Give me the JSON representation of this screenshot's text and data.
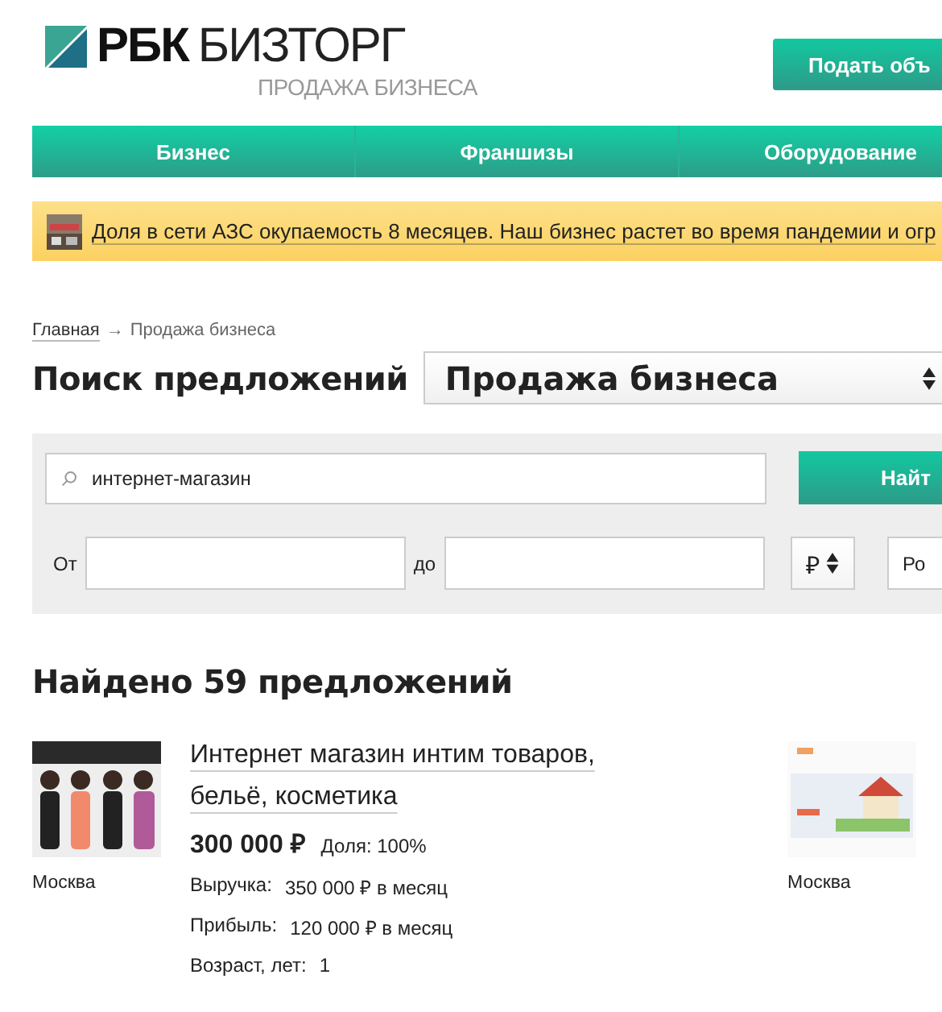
{
  "logo": {
    "brand": "РБК",
    "name": "БИЗТОРГ",
    "tagline": "ПРОДАЖА БИЗНЕСА"
  },
  "post_button": "Подать объ",
  "nav": [
    {
      "label": "Бизнес"
    },
    {
      "label": "Франшизы"
    },
    {
      "label": "Оборудование"
    }
  ],
  "banner": {
    "text": "Доля в сети АЗС окупаемость 8 месяцев. Наш бизнес растет во время пандемии и огр"
  },
  "breadcrumb": {
    "home": "Главная",
    "arrow": "→",
    "current": "Продажа бизнеса"
  },
  "heading": "Поиск предложений",
  "type_select": "Продажа бизнеса",
  "search": {
    "value": "интернет-магазин",
    "button": "Найт",
    "from_label": "От",
    "to_label": "до",
    "currency": "₽",
    "region": "Ро"
  },
  "found": "Найдено 59 предложений",
  "results": [
    {
      "title": "Интернет магазин интим товаров, бельё, косметика",
      "city": "Москва",
      "price": "300 000 ₽",
      "share": "Доля: 100%",
      "stats": [
        {
          "label": "Выручка:",
          "value": "350 000 ₽ в месяц"
        },
        {
          "label": "Прибыль:",
          "value": "120 000 ₽ в месяц"
        },
        {
          "label": "Возраст, лет:",
          "value": "1"
        }
      ],
      "kind": "people"
    },
    {
      "city": "Москва",
      "kind": "site"
    }
  ]
}
